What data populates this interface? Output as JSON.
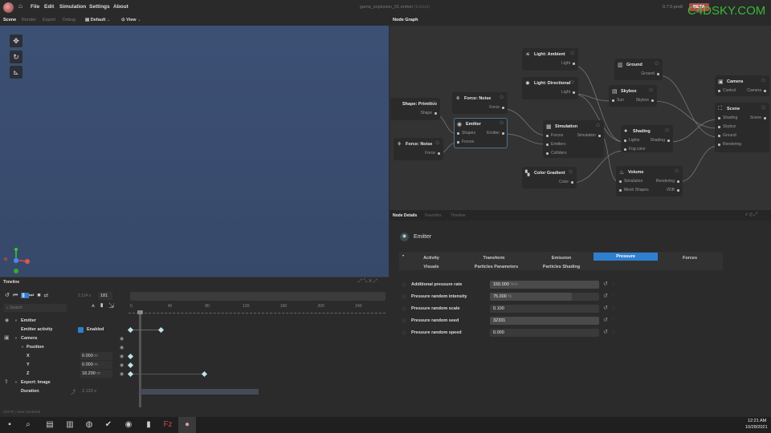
{
  "app": {
    "title": "game_explosion_01.ember",
    "title_suffix": "(Edited)",
    "version": "0.7.5-pre8",
    "badge": "BETA",
    "watermark": "C4DSKY.COM",
    "menu": [
      "File",
      "Edit",
      "Simulation",
      "Settings",
      "About"
    ]
  },
  "viewport": {
    "tabs": [
      "Scene",
      "Render",
      "Export",
      "Debug"
    ],
    "preset": "Default",
    "view": "View"
  },
  "graph": {
    "title": "Node Graph",
    "nodes": [
      {
        "title": "Light: Ambient",
        "icon": "☀",
        "inputs": [],
        "outputs": [
          "Light"
        ]
      },
      {
        "title": "Light: Directional",
        "icon": "✹",
        "inputs": [],
        "outputs": [
          "Light"
        ]
      },
      {
        "title": "Shape: Primitive",
        "icon": "",
        "inputs": [],
        "outputs": [
          "Shape"
        ]
      },
      {
        "title": "Force: Noise",
        "icon": "⚘",
        "inputs": [],
        "outputs": [
          "Force"
        ]
      },
      {
        "title": "Emitter",
        "icon": "◉",
        "inputs": [
          "Shapes",
          "Forces"
        ],
        "outputs": [
          "Emitter"
        ]
      },
      {
        "title": "Force: Noise",
        "icon": "⚘",
        "inputs": [],
        "outputs": [
          "Force"
        ]
      },
      {
        "title": "Simulation",
        "icon": "▦",
        "inputs": [
          "Forces",
          "Emitters",
          "Colliders"
        ],
        "outputs": [
          "Simulation"
        ]
      },
      {
        "title": "Color Gradient",
        "icon": "▚",
        "inputs": [],
        "outputs": [
          "Color"
        ]
      },
      {
        "title": "Ground",
        "icon": "▥",
        "inputs": [],
        "outputs": [
          "Ground"
        ]
      },
      {
        "title": "Skybox",
        "icon": "▤",
        "inputs": [
          "Sun"
        ],
        "outputs": [
          "Skybox"
        ]
      },
      {
        "title": "Shading",
        "icon": "●",
        "inputs": [
          "Lights",
          "Fog color"
        ],
        "outputs": [
          "Shading"
        ]
      },
      {
        "title": "Volume",
        "icon": "♨",
        "inputs": [
          "Simulation",
          "Mesh Shapes"
        ],
        "outputs": [
          "Rendering",
          "VDB"
        ]
      },
      {
        "title": "Camera",
        "icon": "▣",
        "inputs": [
          "Control"
        ],
        "outputs": [
          "Camera"
        ]
      },
      {
        "title": "Scene",
        "icon": "⛶",
        "inputs": [
          "Shading",
          "Skybox",
          "Ground",
          "Rendering"
        ],
        "outputs": [
          "Scene"
        ]
      }
    ]
  },
  "details": {
    "tabs": [
      "Node Details",
      "Favorites",
      "Timeline"
    ],
    "node_title": "Emitter",
    "sections": [
      "Activity",
      "Transform",
      "Emission",
      "Pressure",
      "Forces",
      "Visuals",
      "Particles Parameters",
      "Particles Shading"
    ],
    "active_section": "Pressure",
    "properties": [
      {
        "label": "Additional pressure rate",
        "value": "150.000",
        "unit": "%/s",
        "fill": 1.0
      },
      {
        "label": "Pressure random intensity",
        "value": "75.000",
        "unit": "%",
        "fill": 0.75
      },
      {
        "label": "Pressure random scale",
        "value": "0.100",
        "unit": "",
        "fill": 0
      },
      {
        "label": "Pressure random seed",
        "value": "32331",
        "unit": "",
        "fill": 1.0
      },
      {
        "label": "Pressure random speed",
        "value": "0.000",
        "unit": "",
        "fill": 0
      }
    ]
  },
  "timeline": {
    "title": "Timeline",
    "time": "2.114 s",
    "frame": "181",
    "search_placeholder": "Search",
    "ruler": [
      "0",
      "40",
      "80",
      "120",
      "160",
      "200",
      "240"
    ],
    "rows": {
      "emitter": "Emitter",
      "activity": "Emitter activity",
      "enabled": "Enabled",
      "camera": "Camera",
      "position": "Position",
      "x": "X",
      "x_val": "0.000",
      "y": "Y",
      "y_val": "0.000",
      "z": "Z",
      "z_val": "18.290",
      "unit": "m",
      "export": "Export: Image",
      "duration": "Duration",
      "duration_val": "2.133 s"
    }
  },
  "status": {
    "shortcut": "Ctrl+R",
    "message": "View Centered"
  },
  "taskbar": {
    "time": "12:21 AM",
    "date": "10/28/2021"
  }
}
